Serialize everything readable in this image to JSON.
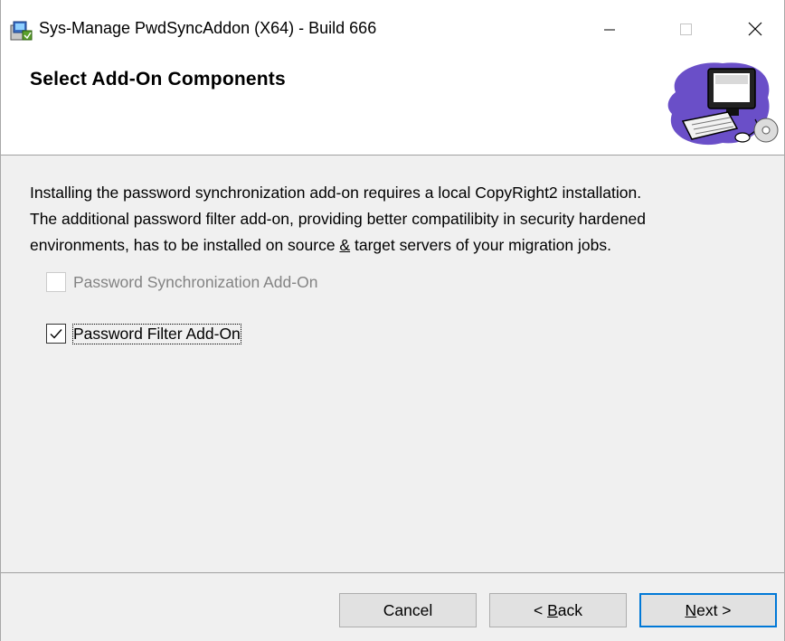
{
  "window": {
    "title": "Sys-Manage PwdSyncAddon (X64) - Build 666"
  },
  "banner": {
    "title": "Select Add-On Components"
  },
  "description": {
    "line1": "Installing the password synchronization add-on requires a local CopyRight2 installation.",
    "line2": "The additional password filter add-on, providing better compatilibity in security hardened",
    "line3_before": "environments, has to be installed on source ",
    "line3_amp": "&",
    "line3_after": " target servers of your migration jobs."
  },
  "options": [
    {
      "label": "Password Synchronization Add-On",
      "checked": false,
      "enabled": false
    },
    {
      "label": "Password Filter Add-On",
      "checked": true,
      "enabled": true
    }
  ],
  "buttons": {
    "cancel": "Cancel",
    "back_prefix": "< ",
    "back_mnemonic": "B",
    "back_rest": "ack",
    "next_mnemonic": "N",
    "next_rest": "ext >"
  },
  "colors": {
    "accent": "#0078d7",
    "dialog_bg": "#f0f0f0",
    "disabled_text": "#838383"
  }
}
